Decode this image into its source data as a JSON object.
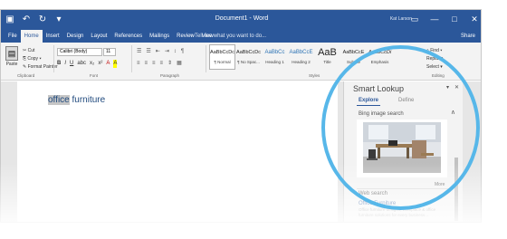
{
  "window": {
    "title": "Document1 - Word",
    "user_name": "Kat Larson",
    "controls": {
      "restore": "▭",
      "minimize": "—",
      "maximize": "□",
      "close": "✕"
    }
  },
  "quick_access": {
    "save": "▣",
    "undo": "↶",
    "redo": "↻",
    "customize": "▾"
  },
  "ribbon_tabs": {
    "items": [
      "File",
      "Home",
      "Insert",
      "Design",
      "Layout",
      "References",
      "Mailings",
      "Review",
      "View"
    ],
    "active": "Home",
    "tell_me": "♀ Tell me what you want to do...",
    "share": "Share"
  },
  "clipboard": {
    "paste": "Paste",
    "cut": "✂ Cut",
    "copy": "⎘ Copy ▾",
    "format_painter": "✎ Format Painter",
    "group_label": "Clipboard"
  },
  "font": {
    "name": "Calibri (Body)",
    "size": "11",
    "format_buttons": [
      "B",
      "I",
      "U",
      "abc",
      "x₂",
      "x²",
      "A",
      "A"
    ],
    "group_label": "Font"
  },
  "paragraph": {
    "row1": [
      "☰",
      "☰",
      "⇤",
      "⇥",
      "↕",
      "¶"
    ],
    "row2": [
      "≡",
      "≡",
      "≡",
      "≡",
      "⇕",
      "▦"
    ],
    "group_label": "Paragraph"
  },
  "styles": {
    "items": [
      {
        "sample": "AaBbCcDc",
        "name": "¶ Normal"
      },
      {
        "sample": "AaBbCcDc",
        "name": "¶ No Spac..."
      },
      {
        "sample": "AaBbCc",
        "name": "Heading 1"
      },
      {
        "sample": "AaBbCcE",
        "name": "Heading 2"
      },
      {
        "sample": "AaB",
        "name": "Title"
      },
      {
        "sample": "AaBbCcE",
        "name": "Subtitle"
      },
      {
        "sample": "AaBbCcDi",
        "name": "Emphasis"
      }
    ],
    "group_label": "Styles"
  },
  "editing": {
    "find": "⌕ Find ▾",
    "replace": "Replace",
    "select": "Select ▾",
    "group_label": "Editing"
  },
  "document": {
    "selected_word": "office",
    "rest_text": " furniture"
  },
  "smart_lookup": {
    "title": "Smart Lookup",
    "tabs": [
      "Explore",
      "Define"
    ],
    "active_tab": "Explore",
    "bing_header": "Bing image search",
    "more_label": "More",
    "web_header": "Web search",
    "result_title": "Office Furniture",
    "result_snippet": "Office furniture designs, workplace & office furniture solutions for every business...",
    "options_glyph": "▾",
    "close_glyph": "✕",
    "collapse_glyph": "∧"
  },
  "highlight_ring_color": "#57b7e9"
}
